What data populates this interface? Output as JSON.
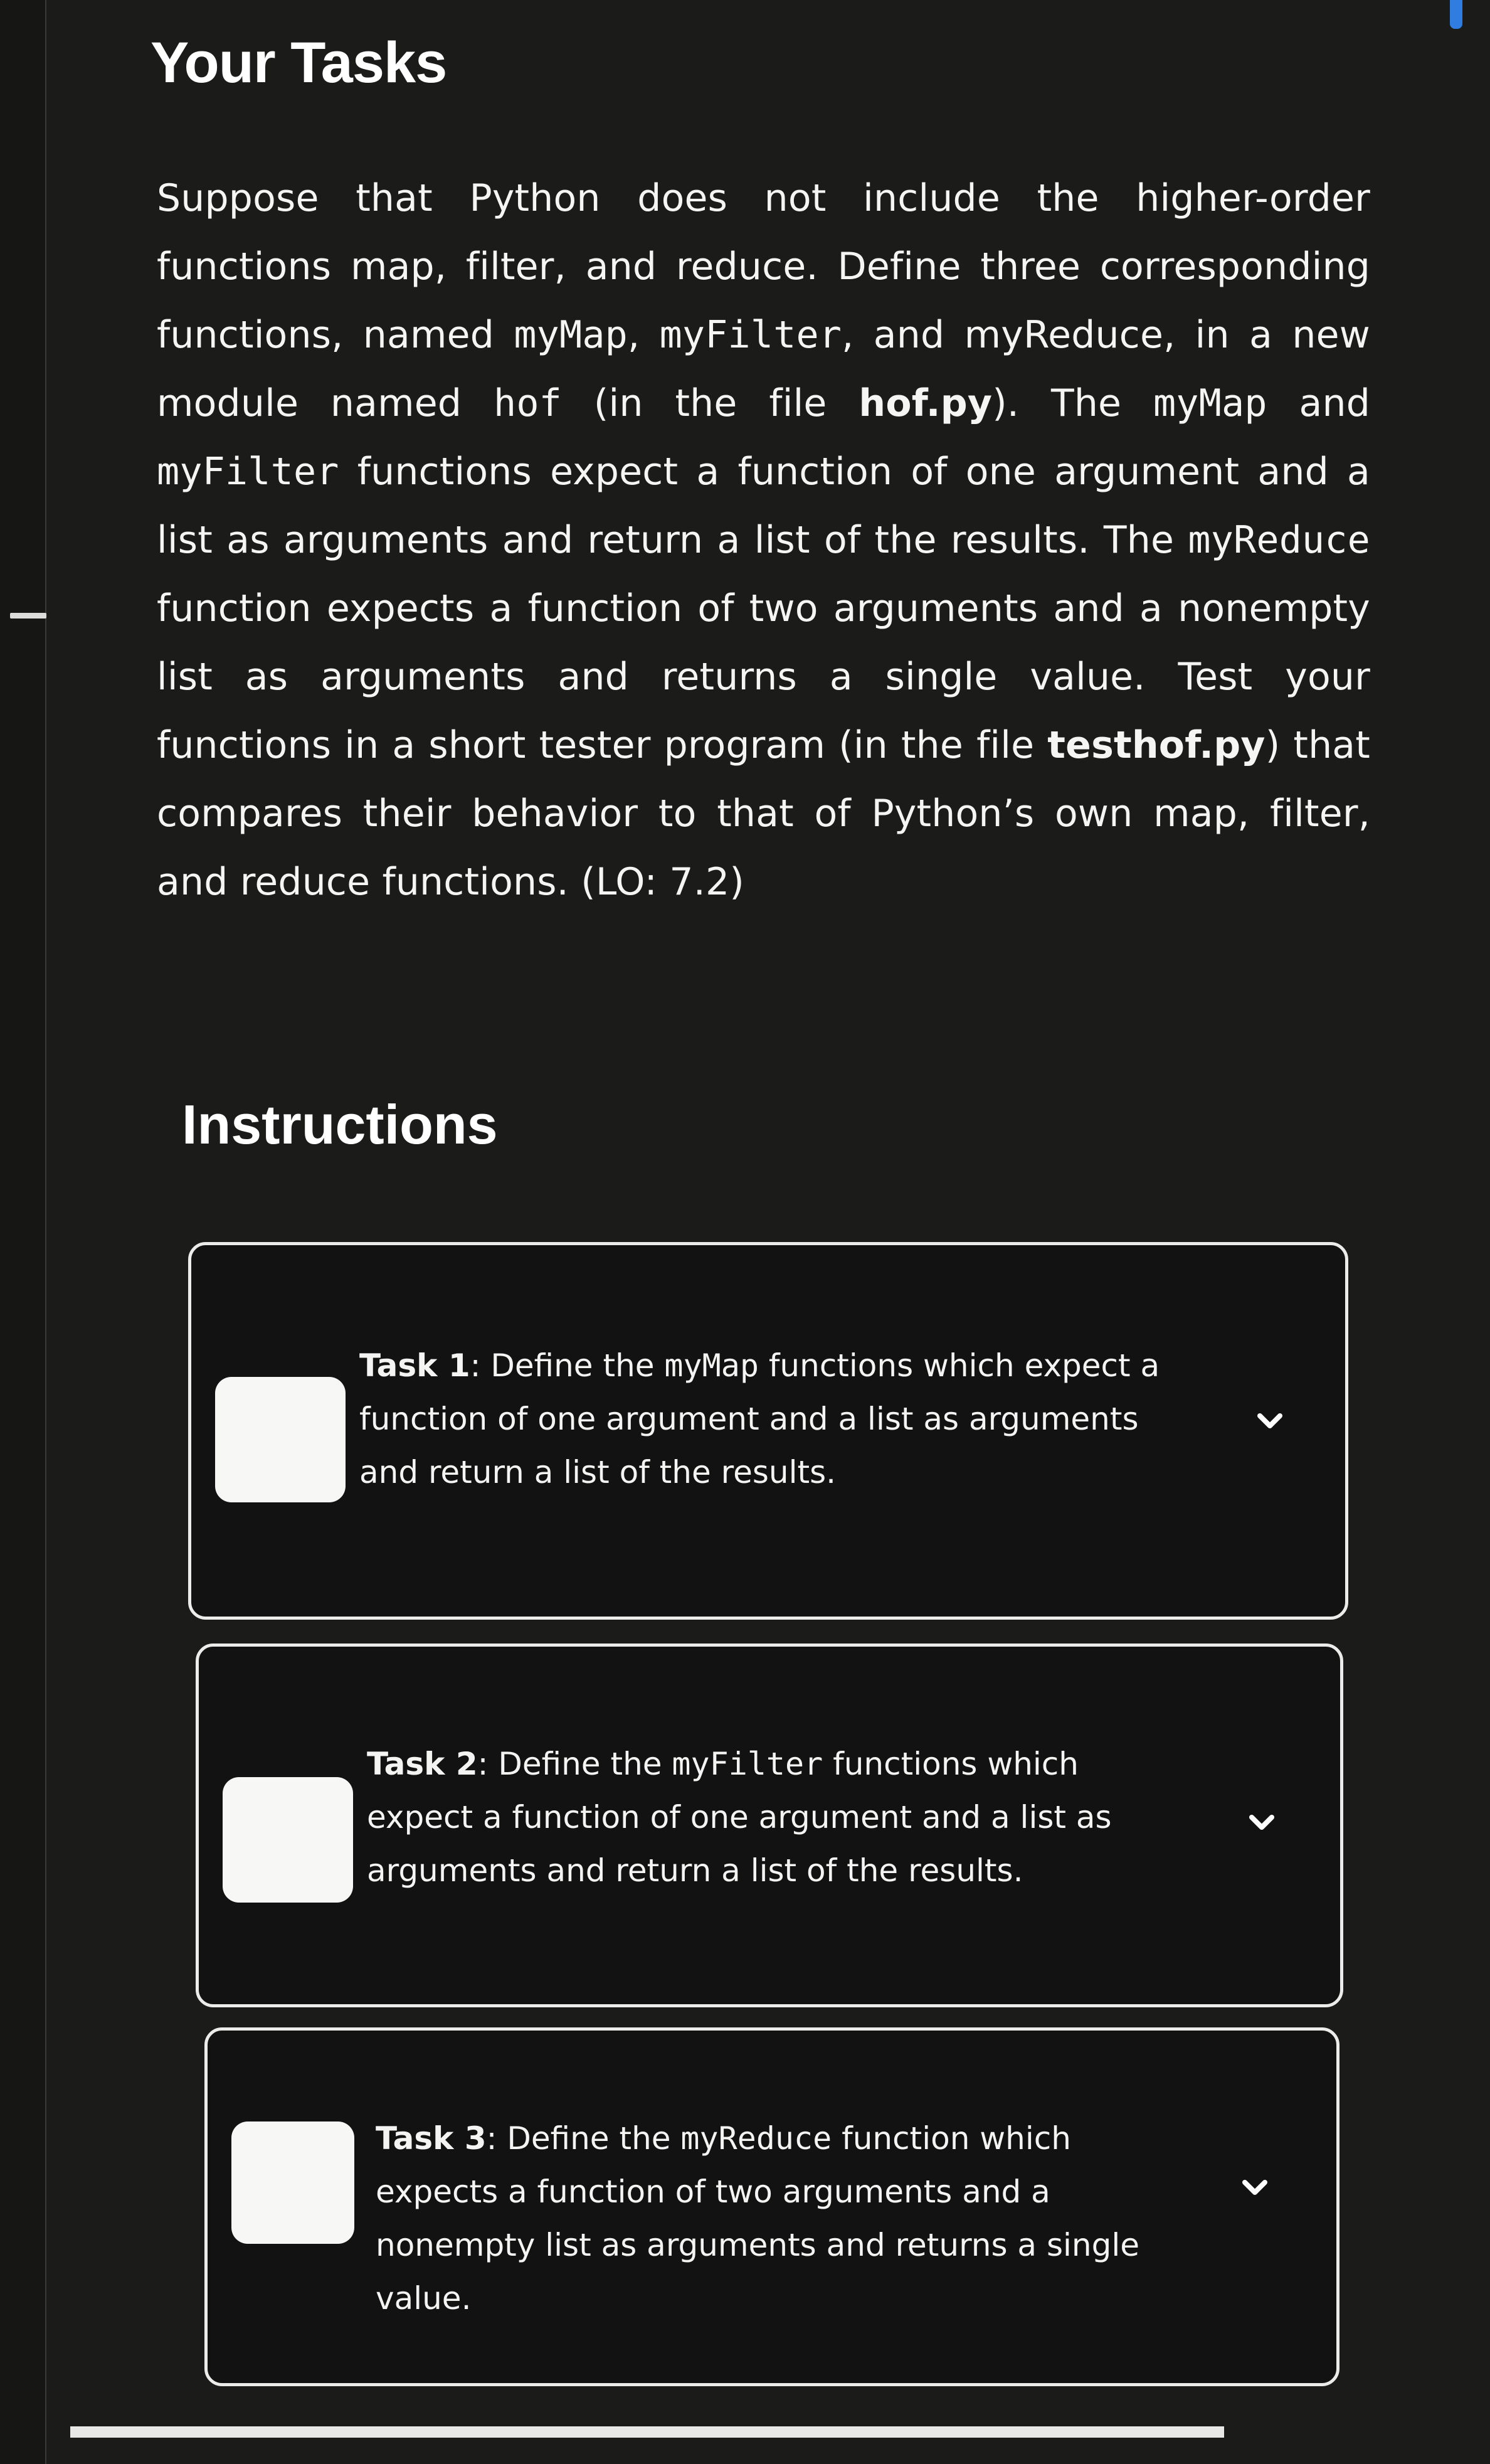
{
  "header": {
    "title": "Your Tasks"
  },
  "description": {
    "segments": [
      {
        "text": "Suppose that Python does not include the higher-order functions map, filter, and reduce. Define three corresponding functions, named ",
        "style": "plain"
      },
      {
        "text": "myMap",
        "style": "plain"
      },
      {
        "text": ", ",
        "style": "plain"
      },
      {
        "text": "myFilter",
        "style": "code"
      },
      {
        "text": ", and myReduce, in a new module named ",
        "style": "plain"
      },
      {
        "text": "hof",
        "style": "code"
      },
      {
        "text": " (in the file ",
        "style": "plain"
      },
      {
        "text": "hof.py",
        "style": "bold"
      },
      {
        "text": "). The ",
        "style": "plain"
      },
      {
        "text": "myMap",
        "style": "code"
      },
      {
        "text": " and ",
        "style": "plain"
      },
      {
        "text": "myFilter",
        "style": "code"
      },
      {
        "text": " functions expect a function of one argument and a list as arguments and return a list of the results. The ",
        "style": "plain"
      },
      {
        "text": "myReduce",
        "style": "code"
      },
      {
        "text": " function expects a function of two arguments and a nonempty list as arguments and returns a single value. Test your functions in a short tester program (in the file ",
        "style": "plain"
      },
      {
        "text": "testhof.py",
        "style": "bold"
      },
      {
        "text": ") that compares their behavior to that of Python’s own map, filter, and reduce functions. (LO: 7.2)",
        "style": "plain"
      }
    ]
  },
  "instructions": {
    "title": "Instructions",
    "tasks": [
      {
        "label": "Task 1",
        "pre": ": Define the ",
        "fn": "myMap",
        "post": " functions which expect a function of one argument and a list as arguments and return a list of the results.",
        "checked": false,
        "expand_icon": "chevron-down-icon"
      },
      {
        "label": "Task 2",
        "pre": ": Define the ",
        "fn": "myFilter",
        "post": " functions which expect a function of one argument and a list as arguments and return a list of the results.",
        "checked": false,
        "expand_icon": "chevron-down-icon"
      },
      {
        "label": "Task 3",
        "pre": ": Define the ",
        "fn": "myReduce",
        "post": " function which expects a function of two arguments and a nonempty list as arguments and returns a single value.",
        "checked": false,
        "expand_icon": "chevron-down-icon"
      }
    ]
  },
  "colors": {
    "background": "#1b1b1a",
    "card_background": "#121212",
    "card_border": "#ececea",
    "text": "#f4f4f2",
    "scroll_accent": "#2f7de0"
  }
}
